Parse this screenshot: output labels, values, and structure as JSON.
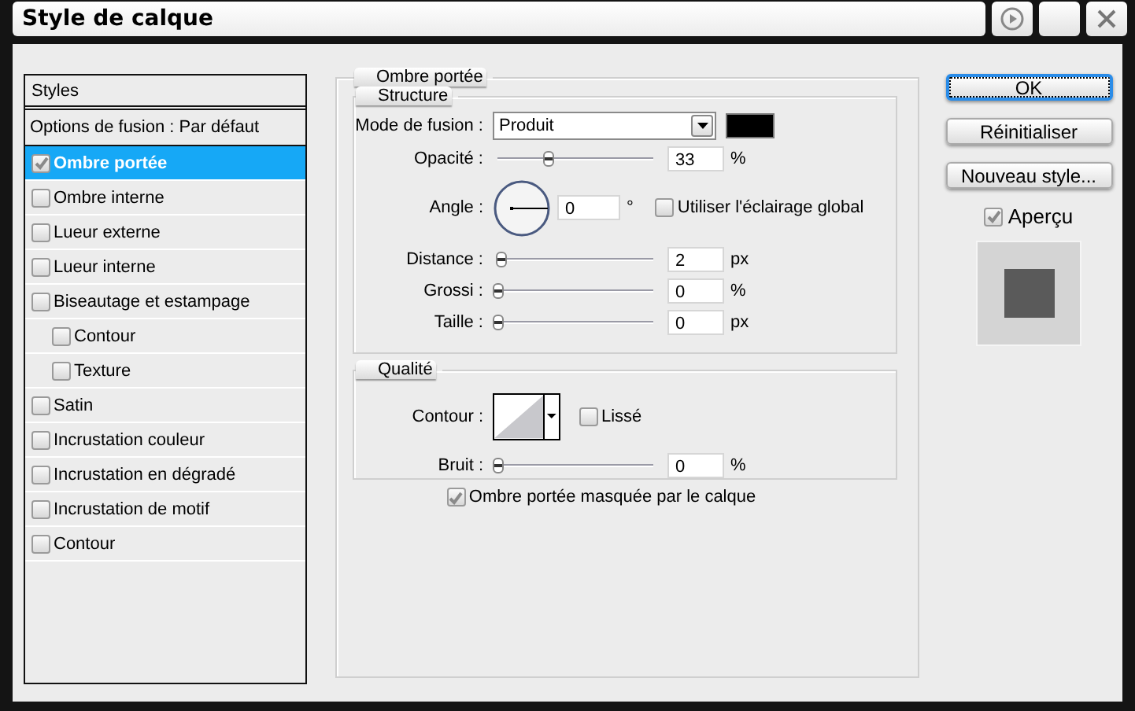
{
  "window": {
    "title": "Style de calque"
  },
  "styles_list": {
    "header": "Styles",
    "options_row": "Options de fusion : Par défaut",
    "items": [
      {
        "label": "Ombre portée",
        "checked": true,
        "selected": true
      },
      {
        "label": "Ombre interne",
        "checked": false,
        "selected": false
      },
      {
        "label": "Lueur externe",
        "checked": false,
        "selected": false
      },
      {
        "label": "Lueur interne",
        "checked": false,
        "selected": false
      },
      {
        "label": "Biseautage et estampage",
        "checked": false,
        "selected": false,
        "children": [
          {
            "label": "Contour",
            "checked": false,
            "selected": false
          },
          {
            "label": "Texture",
            "checked": false,
            "selected": false
          }
        ]
      },
      {
        "label": "Satin",
        "checked": false,
        "selected": false
      },
      {
        "label": "Incrustation couleur",
        "checked": false,
        "selected": false
      },
      {
        "label": "Incrustation en dégradé",
        "checked": false,
        "selected": false
      },
      {
        "label": "Incrustation de motif",
        "checked": false,
        "selected": false
      },
      {
        "label": "Contour",
        "checked": false,
        "selected": false
      }
    ]
  },
  "effect": {
    "title": "Ombre portée",
    "structure": {
      "title": "Structure",
      "rows": [
        {
          "kind": "select",
          "label": "Mode de fusion :",
          "value": "Produit",
          "color": "#000000"
        },
        {
          "kind": "slider",
          "label": "Opacité :",
          "level": 0.33,
          "value": "33",
          "unit": "%"
        },
        {
          "kind": "angle",
          "label": "Angle :",
          "value": "0",
          "unit": "°",
          "option": {
            "label": "Utiliser l'éclairage global",
            "checked": false
          }
        },
        {
          "kind": "slider",
          "label": "Distance :",
          "level": 0.02,
          "value": "2",
          "unit": "px"
        },
        {
          "kind": "slider",
          "label": "Grossi :",
          "level": 0,
          "value": "0",
          "unit": "%"
        },
        {
          "kind": "slider",
          "label": "Taille :",
          "level": 0,
          "value": "0",
          "unit": "px"
        }
      ]
    },
    "quality": {
      "title": "Qualité",
      "rows": [
        {
          "kind": "contour",
          "label": "Contour :",
          "option": {
            "label": "Lissé",
            "checked": false
          }
        },
        {
          "kind": "slider",
          "label": "Bruit :",
          "level": 0,
          "value": "0",
          "unit": "%"
        }
      ]
    },
    "knockout": {
      "label": "Ombre portée masquée par le calque",
      "checked": true
    }
  },
  "buttons": [
    {
      "label": "OK",
      "focused": true
    },
    {
      "label": "Réinitialiser",
      "focused": false
    },
    {
      "label": "Nouveau style...",
      "focused": false
    }
  ],
  "preview": {
    "label": "Aperçu",
    "checked": true
  }
}
